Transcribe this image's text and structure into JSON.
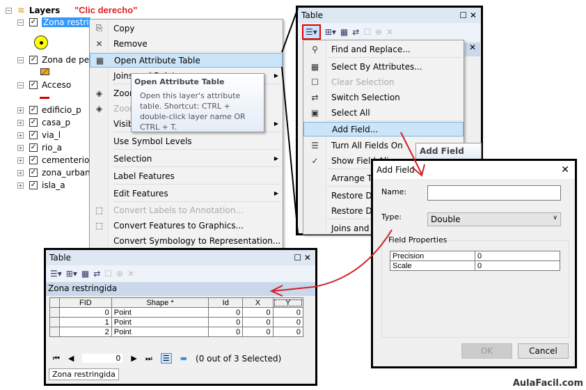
{
  "toc": {
    "root": "Layers",
    "annotation": "\"Clic derecho\"",
    "layers": [
      {
        "name": "Zona restringida",
        "exp": "−",
        "selected": true
      },
      {
        "name": "Zona de pesca",
        "exp": "−"
      },
      {
        "name": "Acceso",
        "exp": "−"
      },
      {
        "name": "edificio_p",
        "exp": "+"
      },
      {
        "name": "casa_p",
        "exp": "+"
      },
      {
        "name": "via_l",
        "exp": "+"
      },
      {
        "name": "rio_a",
        "exp": "+"
      },
      {
        "name": "cementerio_a",
        "exp": "+"
      },
      {
        "name": "zona_urbana",
        "exp": "+"
      },
      {
        "name": "isla_a",
        "exp": "+"
      }
    ]
  },
  "context_menu": {
    "items": [
      {
        "label": "Copy",
        "icon": "copy-icon",
        "glyph": "⎘"
      },
      {
        "label": "Remove",
        "icon": "remove-icon",
        "glyph": "✕"
      },
      {
        "label": "Open Attribute Table",
        "icon": "table-icon",
        "glyph": "▦",
        "highlight": true
      },
      {
        "label": "Joins and Relates",
        "submenu": true
      },
      {
        "label": "Zoom To Layer",
        "icon": "zoom-layer-icon",
        "glyph": "◈"
      },
      {
        "label": "Zoom To Make Visible",
        "icon": "zoom-visible-icon",
        "glyph": "◈",
        "disabled": true
      },
      {
        "label": "Visible Scale Range",
        "submenu": true
      },
      {
        "label": "Use Symbol Levels"
      },
      {
        "label": "Selection",
        "submenu": true
      },
      {
        "label": "Label Features"
      },
      {
        "label": "Edit Features",
        "submenu": true
      },
      {
        "label": "Convert Labels to Annotation...",
        "icon": "convert-labels-icon",
        "glyph": "⬚",
        "disabled": true
      },
      {
        "label": "Convert Features to Graphics...",
        "icon": "convert-graphics-icon",
        "glyph": "⬚"
      },
      {
        "label": "Convert Symbology to Representation..."
      }
    ]
  },
  "tooltip": {
    "title": "Open Attribute Table",
    "body": "Open this layer's attribute table. Shortcut: CTRL + double-click layer name OR CTRL + T."
  },
  "top_table": {
    "title": "Table",
    "menu": [
      {
        "label": "Find and Replace...",
        "glyph": "⚲"
      },
      {
        "label": "Select By Attributes...",
        "glyph": "▦"
      },
      {
        "label": "Clear Selection",
        "glyph": "☐",
        "disabled": true
      },
      {
        "label": "Switch Selection",
        "glyph": "⇄"
      },
      {
        "label": "Select All",
        "glyph": "▣"
      },
      {
        "label": "Add Field...",
        "highlight": true
      },
      {
        "label": "Turn All Fields On",
        "glyph": "☰"
      },
      {
        "label": "Show Field Aliases",
        "glyph": "✓"
      },
      {
        "label": "Arrange Tables"
      },
      {
        "label": "Restore Default Column Widths"
      },
      {
        "label": "Restore Default Field Order"
      },
      {
        "label": "Joins and Relates"
      }
    ],
    "hover_tooltip": "Add Field"
  },
  "add_field": {
    "title": "Add Field",
    "name_label": "Name:",
    "name_value": "",
    "type_label": "Type:",
    "type_value": "Double",
    "group": "Field Properties",
    "props": [
      {
        "k": "Precision",
        "v": "0"
      },
      {
        "k": "Scale",
        "v": "0"
      }
    ],
    "ok": "OK",
    "cancel": "Cancel"
  },
  "bottom_table": {
    "title": "Table",
    "layer": "Zona restringida",
    "columns": [
      "FID",
      "Shape *",
      "Id",
      "X",
      "Y"
    ],
    "rows": [
      [
        "0",
        "Point",
        "0",
        "0",
        "0"
      ],
      [
        "1",
        "Point",
        "0",
        "0",
        "0"
      ],
      [
        "2",
        "Point",
        "0",
        "0",
        "0"
      ]
    ],
    "record": "0",
    "status": "(0 out of 3 Selected)",
    "tab": "Zona restringida"
  },
  "watermark": "AulaFacil.com",
  "colors": {
    "annotation": "#e02020",
    "selection": "#3399ff",
    "highlight": "#cce4f7",
    "arrow": "#d0202a"
  }
}
